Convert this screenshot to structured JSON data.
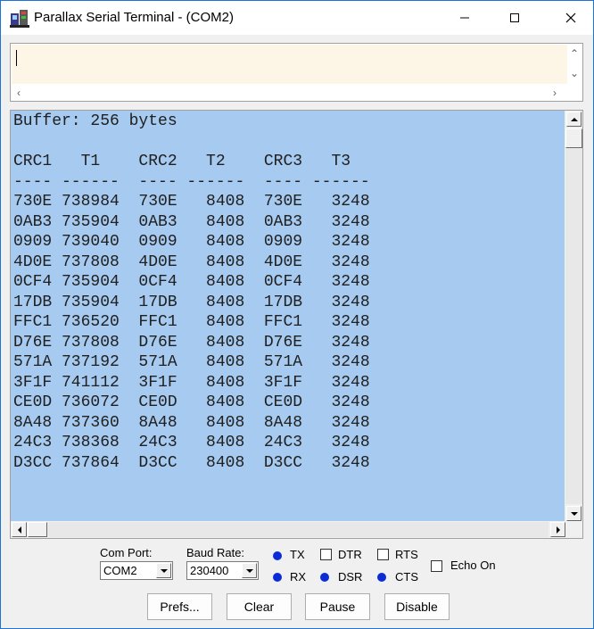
{
  "window": {
    "title": "Parallax Serial Terminal - (COM2)"
  },
  "terminal": {
    "lines": [
      "Buffer: 256 bytes",
      "",
      "CRC1   T1    CRC2   T2    CRC3   T3",
      "---- ------  ---- ------  ---- ------",
      "730E 738984  730E   8408  730E   3248",
      "0AB3 735904  0AB3   8408  0AB3   3248",
      "0909 739040  0909   8408  0909   3248",
      "4D0E 737808  4D0E   8408  4D0E   3248",
      "0CF4 735904  0CF4   8408  0CF4   3248",
      "17DB 735904  17DB   8408  17DB   3248",
      "FFC1 736520  FFC1   8408  FFC1   3248",
      "D76E 737808  D76E   8408  D76E   3248",
      "571A 737192  571A   8408  571A   3248",
      "3F1F 741112  3F1F   8408  3F1F   3248",
      "CE0D 736072  CE0D   8408  CE0D   3248",
      "8A48 737360  8A48   8408  8A48   3248",
      "24C3 738368  24C3   8408  24C3   3248",
      "D3CC 737864  D3CC   8408  D3CC   3248"
    ]
  },
  "controls": {
    "com_port_label": "Com Port:",
    "com_port_value": "COM2",
    "baud_rate_label": "Baud Rate:",
    "baud_rate_value": "230400",
    "tx_label": "TX",
    "rx_label": "RX",
    "dtr_label": "DTR",
    "dsr_label": "DSR",
    "rts_label": "RTS",
    "cts_label": "CTS",
    "echo_label": "Echo On",
    "led_color": "#0a2bd6"
  },
  "buttons": {
    "prefs": "Prefs...",
    "clear": "Clear",
    "pause": "Pause",
    "disable": "Disable"
  }
}
